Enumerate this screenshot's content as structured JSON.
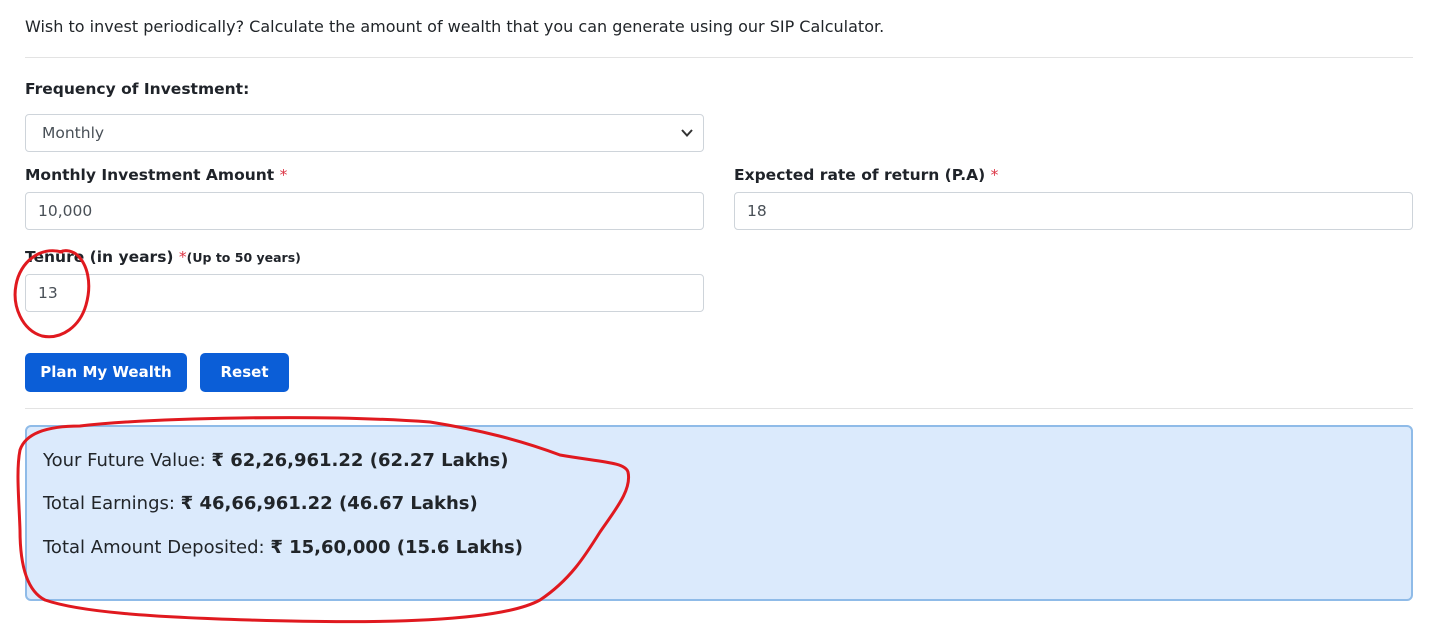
{
  "intro": "Wish to invest periodically? Calculate the amount of wealth that you can generate using our SIP Calculator.",
  "frequency": {
    "label": "Frequency of Investment:",
    "selected": "Monthly"
  },
  "monthly_amount": {
    "label": "Monthly Investment Amount",
    "required": "*",
    "value": "10,000"
  },
  "rate": {
    "label": "Expected rate of return (P.A)",
    "required": "*",
    "value": "18"
  },
  "tenure": {
    "label": "Tenure (in years)",
    "required": "*",
    "note": "(Up to 50 years)",
    "value": "13"
  },
  "buttons": {
    "plan": "Plan My Wealth",
    "reset": "Reset"
  },
  "results": {
    "future_value_label": "Your Future Value:",
    "future_value": "₹  62,26,961.22 (62.27 Lakhs)",
    "earnings_label": "Total Earnings:",
    "earnings": "₹ 46,66,961.22 (46.67 Lakhs)",
    "deposited_label": "Total Amount Deposited:",
    "deposited": "₹ 15,60,000 (15.6 Lakhs)"
  },
  "colors": {
    "primary": "#0b5ed7",
    "required": "#dc3545",
    "result_bg": "#dbeafc",
    "annotation": "#e0191f"
  }
}
